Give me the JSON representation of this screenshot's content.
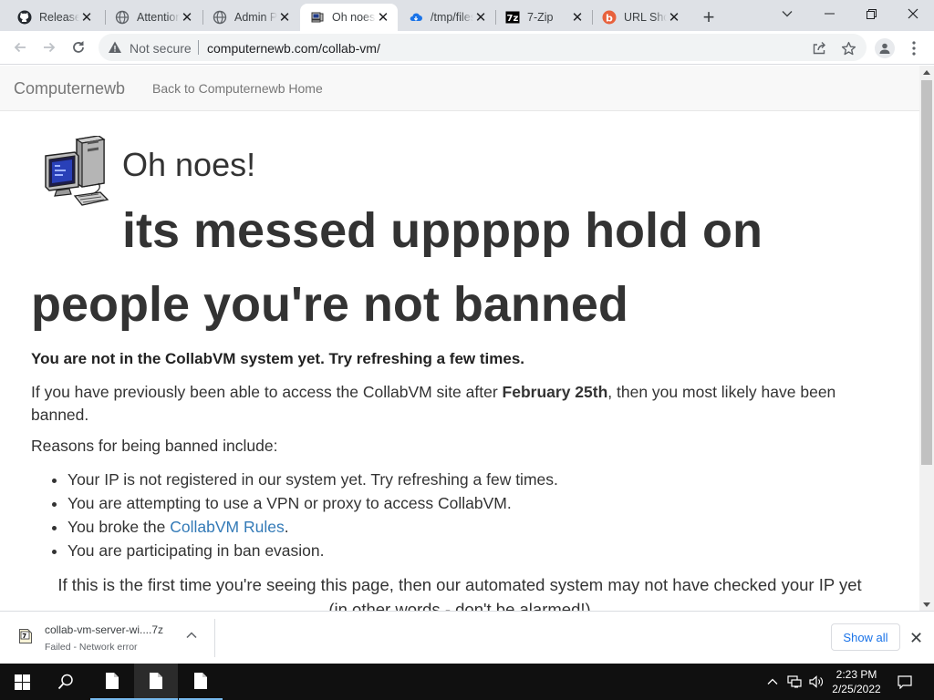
{
  "browser": {
    "tabs": [
      {
        "title": "Releases",
        "icon": "github-icon",
        "active": false
      },
      {
        "title": "Attention",
        "icon": "globe-icon",
        "active": false
      },
      {
        "title": "Admin Panel",
        "icon": "globe-icon",
        "active": false
      },
      {
        "title": "Oh noes!",
        "icon": "computer-favicon",
        "active": true
      },
      {
        "title": "/tmp/files",
        "icon": "cloud-icon",
        "active": false
      },
      {
        "title": "7-Zip",
        "icon": "7zip-icon",
        "active": false
      },
      {
        "title": "URL Shortener",
        "icon": "url-shortener-icon",
        "active": false
      }
    ],
    "security_label": "Not secure",
    "url": "computernewb.com/collab-vm/"
  },
  "site": {
    "brand": "Computernewb",
    "home_link": "Back to Computernewb Home"
  },
  "page": {
    "heading_small": "Oh noes!",
    "heading_big_1": "its messed uppppp hold on",
    "heading_big_2": "people you're not banned",
    "lead": "You are not in the CollabVM system yet. Try refreshing a few times.",
    "p1_before": "If you have previously been able to access the CollabVM site after ",
    "p1_bold": "February 25th",
    "p1_after": ", then you most likely have been banned.",
    "reasons_intro": "Reasons for being banned include:",
    "reasons": [
      "Your IP is not registered in our system yet. Try refreshing a few times.",
      "You are attempting to use a VPN or proxy to access CollabVM.",
      "You broke the ",
      "You are participating in ban evasion."
    ],
    "rules_link": "CollabVM Rules",
    "rules_after": ".",
    "footer_line_1": "If this is the first time you're seeing this page, then our automated system may not have checked your IP yet",
    "footer_line_2": "(in other words - don't be alarmed!)"
  },
  "downloads": {
    "file_name": "collab-vm-server-wi....7z",
    "status": "Failed - Network error",
    "show_all": "Show all"
  },
  "taskbar": {
    "time": "2:23 PM",
    "date": "2/25/2022"
  },
  "colors": {
    "link": "#337ab7",
    "text": "#333333",
    "chrome_frame": "#dee1e6",
    "taskbar": "#101010"
  }
}
